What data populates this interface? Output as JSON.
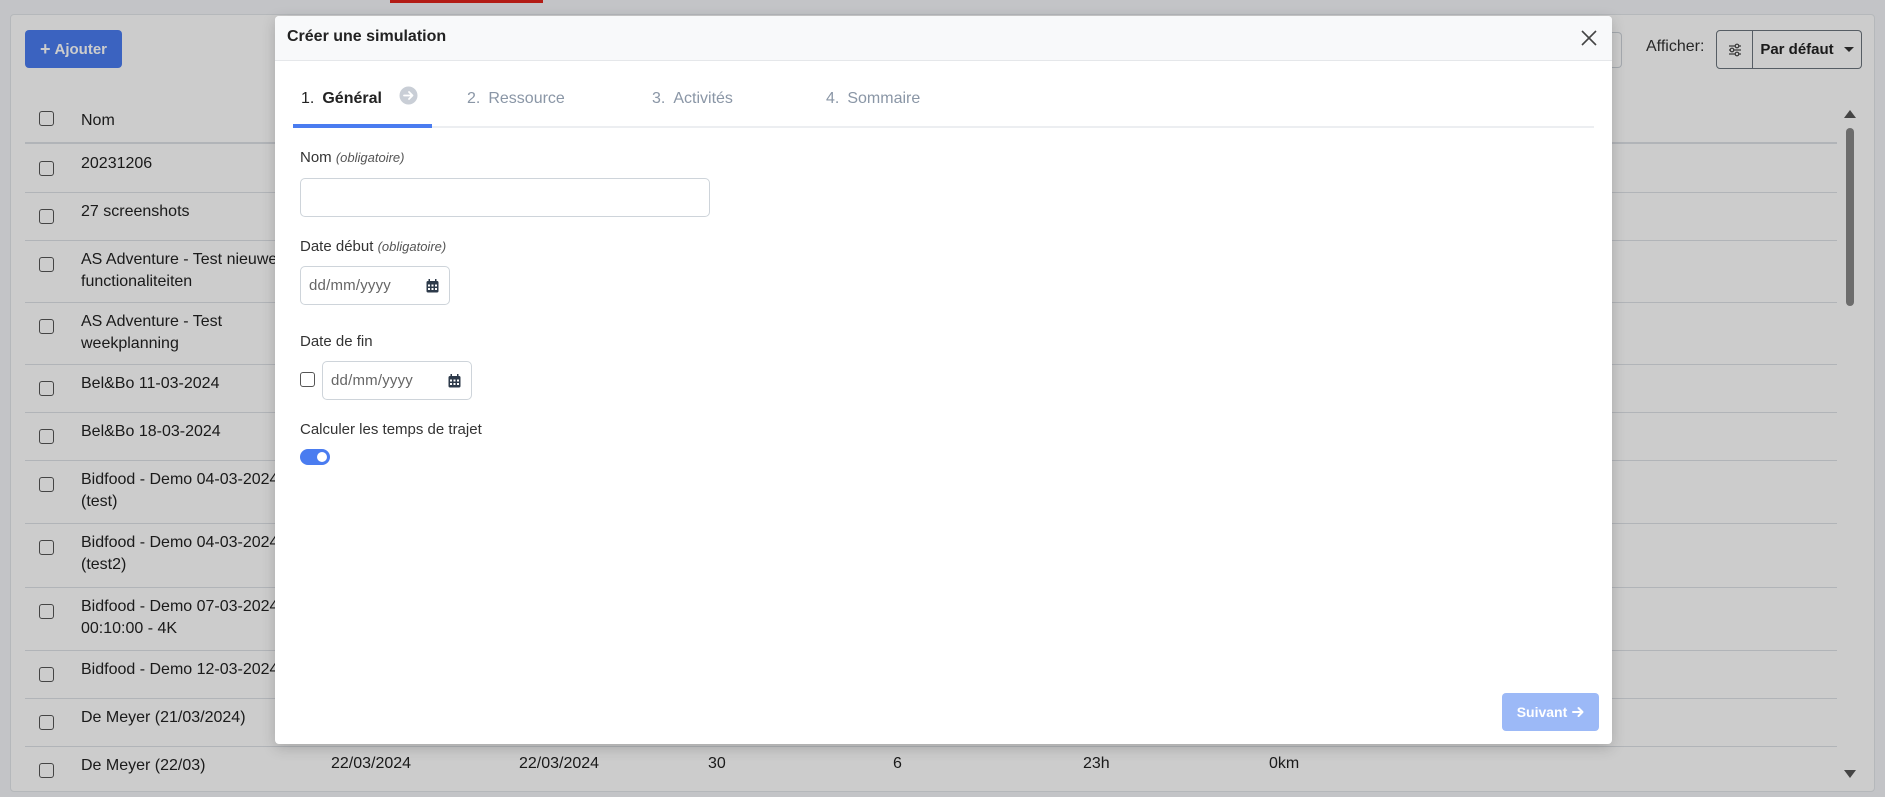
{
  "toolbar": {
    "add_label": "Ajouter",
    "afficher_label": "Afficher:",
    "view_select_value": "Par défaut"
  },
  "table": {
    "header_name": "Nom",
    "rows": [
      {
        "lines": [
          "20231206"
        ]
      },
      {
        "lines": [
          "27 screenshots"
        ]
      },
      {
        "lines": [
          "AS Adventure - Test nieuwe",
          "functionaliteiten"
        ]
      },
      {
        "lines": [
          "AS Adventure - Test",
          "weekplanning"
        ]
      },
      {
        "lines": [
          "Bel&Bo 11-03-2024"
        ]
      },
      {
        "lines": [
          "Bel&Bo 18-03-2024"
        ]
      },
      {
        "lines": [
          "Bidfood - Demo 04-03-2024",
          "(test)"
        ]
      },
      {
        "lines": [
          "Bidfood - Demo 04-03-2024",
          "(test2)"
        ]
      },
      {
        "lines": [
          "Bidfood - Demo 07-03-2024",
          "00:10:00 - 4K"
        ]
      },
      {
        "lines": [
          "Bidfood - Demo 12-03-2024"
        ]
      },
      {
        "lines": [
          "De Meyer (21/03/2024)"
        ]
      },
      {
        "lines": [
          "De Meyer (22/03)"
        ],
        "start": "22/03/2024",
        "end": "22/03/2024",
        "col3": "30",
        "col4": "6",
        "duration": "23h",
        "distance": "0km"
      }
    ]
  },
  "modal": {
    "title": "Créer une simulation",
    "steps": [
      {
        "num": "1.",
        "label": "Général"
      },
      {
        "num": "2.",
        "label": "Ressource"
      },
      {
        "num": "3.",
        "label": "Activités"
      },
      {
        "num": "4.",
        "label": "Sommaire"
      }
    ],
    "active_step": 1,
    "name_label": "Nom",
    "required_hint": "(obligatoire)",
    "name_value": "",
    "start_label": "Date début",
    "date_placeholder": "dd/mm/yyyy",
    "end_label": "Date de fin",
    "end_enabled": false,
    "travel_label": "Calculer les temps de trajet",
    "travel_enabled": true,
    "next_label": "Suivant"
  },
  "colors": {
    "primary": "#4a7cf0",
    "primary_disabled": "#9cb9f7",
    "accent_red": "#e0241b"
  },
  "icons": [
    "plus-icon",
    "sliders-icon",
    "caret-down-icon",
    "close-icon",
    "arrow-right-circle-icon",
    "calendar-icon",
    "arrow-right-icon"
  ]
}
